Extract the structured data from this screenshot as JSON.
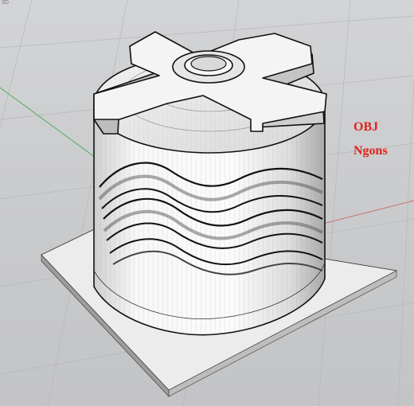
{
  "viewport": {
    "label": "3D"
  },
  "annotation": {
    "line1": "OBJ",
    "line2": "Ngons",
    "color": "#e2231a"
  },
  "scene": {
    "background": "#c9cacc",
    "grid_color": "#b8b9bb",
    "x_axis_color": "#c97070",
    "y_axis_color": "#4fae5a",
    "model_fill": "#f2f2f2",
    "edge_color": "#111111"
  }
}
